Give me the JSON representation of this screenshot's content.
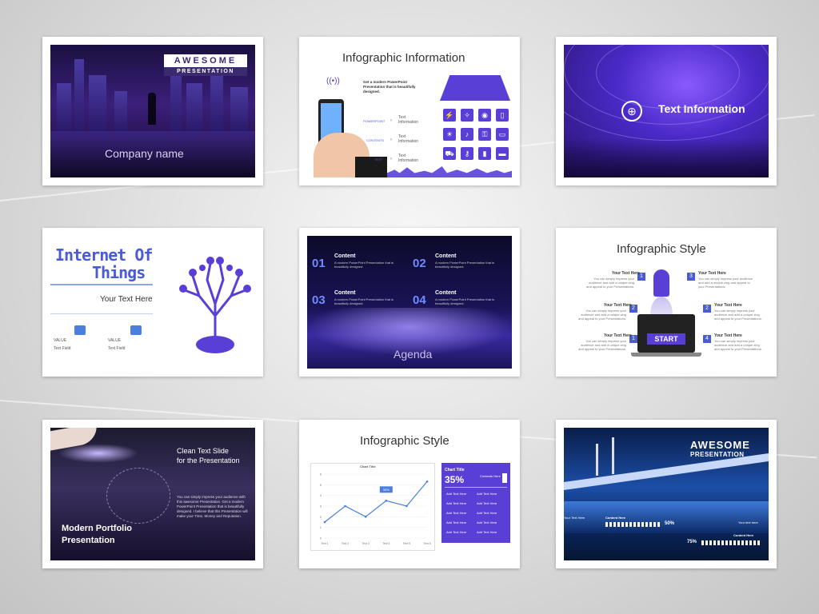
{
  "slides": {
    "s1": {
      "brand_line1": "AWESOME",
      "brand_line2": "PRESENTATION",
      "company": "Company name"
    },
    "s2": {
      "title": "Infographic Information",
      "intro": "Get a modern PowerPoint Presentation that is beautifully designed.",
      "rows": [
        {
          "tag": "POWERPOINT",
          "text": "Text Information"
        },
        {
          "tag": "CONTENTS",
          "text": "Text Information"
        },
        {
          "tag": "TEXT",
          "text": "Text Information"
        }
      ]
    },
    "s3": {
      "title": "Text Information"
    },
    "s4": {
      "title_line1": "Internet Of",
      "title_line2": "Things",
      "subtitle": "Your Text Here",
      "items": [
        {
          "label": "VALUE",
          "text": "Text Field"
        },
        {
          "label": "VALUE",
          "text": "Text Field"
        }
      ]
    },
    "s5": {
      "items": [
        {
          "num": "01",
          "head": "Content",
          "body": "A modern PowerPoint Presentation that is beautifully designed."
        },
        {
          "num": "02",
          "head": "Content",
          "body": "A modern PowerPoint Presentation that is beautifully designed."
        },
        {
          "num": "03",
          "head": "Content",
          "body": "A modern PowerPoint Presentation that is beautifully designed."
        },
        {
          "num": "04",
          "head": "Content",
          "body": "A modern PowerPoint Presentation that is beautifully designed."
        }
      ],
      "footer": "Agenda"
    },
    "s6": {
      "title": "Infographic Style",
      "start": "START",
      "items": [
        {
          "num": "1",
          "head": "Your Text Here",
          "body": "You can simply impress your audience and add a unique zing and appeal to your Presentations."
        },
        {
          "num": "2",
          "head": "Your Text Here",
          "body": "You can simply impress your audience and add a unique zing and appeal to your Presentations."
        },
        {
          "num": "3",
          "head": "Your Text Here",
          "body": "You can simply impress your audience and add a unique zing and appeal to your Presentations."
        },
        {
          "num": "2",
          "head": "Your Text Here",
          "body": "You can simply impress your audience and add a unique zing and appeal to your Presentations."
        },
        {
          "num": "1",
          "head": "Your Text Here",
          "body": "You can simply impress your audience and add a unique zing and appeal to your Presentations."
        },
        {
          "num": "4",
          "head": "Your Text Here",
          "body": "You can simply impress your audience and add a unique zing and appeal to your Presentations."
        }
      ]
    },
    "s7": {
      "heading_line1": "Clean Text Slide",
      "heading_line2": "for the Presentation",
      "body": "You can simply impress your audience with this awesome Presentation. Get a modern PowerPoint Presentation that is beautifully designed. I believe that this Presentation will make your Time, Money and Reputation.",
      "footer_line1": "Modern Portfolio",
      "footer_line2": "Presentation"
    },
    "s8": {
      "title": "Infographic Style",
      "chart_title": "Chart Title",
      "callout": "30%",
      "panel_title": "Chart Title",
      "panel_pct": "35%",
      "panel_side": "Contents Here",
      "rows": [
        "Add Text Here",
        "Add Text Here",
        "Add Text Here",
        "Add Text Here",
        "Add Text Here",
        "Add Text Here"
      ]
    },
    "s9": {
      "brand_line1": "AWESOME",
      "brand_line2": "PRESENTATION",
      "left_text": "Your Text Here",
      "content1": "Content Here",
      "pct1": "50%",
      "right_text": "Your text here",
      "content2": "Content Here",
      "pct2": "75%"
    }
  },
  "chart_data": {
    "type": "line",
    "title": "Chart Title",
    "categories": [
      "Text 1",
      "Text 2",
      "Text 3",
      "Text 4",
      "Text 5",
      "Text 6"
    ],
    "series": [
      {
        "values": [
          1.5,
          3,
          2,
          3.5,
          3,
          5.3
        ]
      }
    ],
    "ylim": [
      0,
      6
    ],
    "yticks": [
      "0",
      "1",
      "2",
      "3",
      "4",
      "5",
      "6"
    ],
    "annotation": {
      "category": "Text 4",
      "label": "30%"
    },
    "color": "#4a7fe0"
  },
  "colors": {
    "accent": "#5a3fd6",
    "title_blue": "#4a5bd6"
  }
}
